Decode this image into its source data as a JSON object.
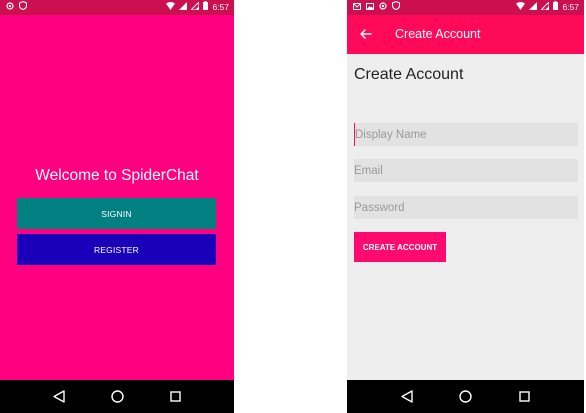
{
  "colors": {
    "left_background": "#ff0080",
    "status_bar": "#cc0f4f",
    "signin_button": "#008080",
    "register_button": "#1a00b8",
    "toolbar": "#ff0a5a",
    "create_button": "#ff0a6e",
    "right_background": "#eeeeee",
    "nav_bar": "#000000"
  },
  "left": {
    "status_bar": {
      "time": "6:57",
      "icons": [
        "circle-notification-icon",
        "shield-icon",
        "wifi-icon",
        "signal-icon",
        "signal-icon",
        "battery-icon"
      ]
    },
    "welcome_text": "Welcome to SpiderChat",
    "signin_label": "SIGNIN",
    "register_label": "REGISTER"
  },
  "right": {
    "status_bar": {
      "time": "6:57",
      "icons": [
        "mail-icon",
        "image-icon",
        "circle-notification-icon",
        "shield-icon",
        "wifi-icon",
        "signal-icon",
        "signal-icon",
        "battery-icon"
      ]
    },
    "toolbar_title": "Create Account",
    "heading": "Create Account",
    "display_name_placeholder": "Display Name",
    "email_placeholder": "Email",
    "password_placeholder": "Password",
    "create_label": "CREATE ACCOUNT"
  },
  "nav_icons": [
    "back-triangle-icon",
    "home-circle-icon",
    "recents-square-icon"
  ]
}
